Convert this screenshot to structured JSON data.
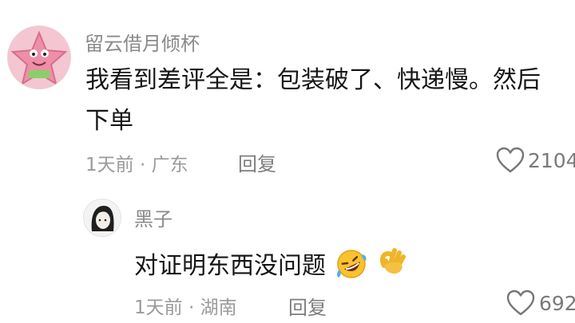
{
  "comments": [
    {
      "username": "留云借月倾杯",
      "text_line1": "我看到差评全是：包装破了、快递慢。然后",
      "text_line2": "下单",
      "meta": "1天前 · 广东",
      "reply_label": "回复",
      "likes": "2104"
    },
    {
      "username": "黑子",
      "text": "对证明东西没问题",
      "emoji_icons": [
        "rolling-on-floor-laughing-icon",
        "ok-hand-icon"
      ],
      "meta": "1天前 · 湖南",
      "reply_label": "回复",
      "likes": "692"
    }
  ],
  "colors": {
    "username": "#8a8a8a",
    "text": "#161616",
    "meta": "#9a9a9a",
    "avatar_bg": "#f4c6d2"
  }
}
